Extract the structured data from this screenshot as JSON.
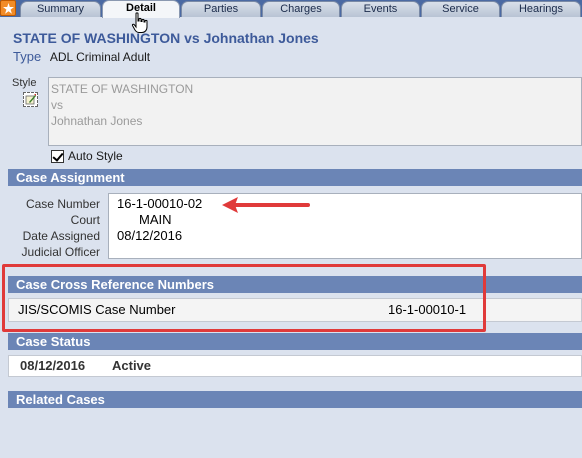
{
  "tabs": [
    "Summary",
    "Detail",
    "Parties",
    "Charges",
    "Events",
    "Service",
    "Hearings"
  ],
  "active_tab": "Detail",
  "case": {
    "title": "STATE OF WASHINGTON vs Johnathan Jones",
    "type_label": "Type",
    "type_value": "ADL Criminal Adult"
  },
  "style": {
    "label": "Style",
    "lines": [
      "STATE OF WASHINGTON",
      "vs",
      "Johnathan Jones"
    ],
    "auto_style_label": "Auto Style",
    "auto_style_checked": true
  },
  "case_assignment": {
    "header": "Case Assignment",
    "labels": [
      "Case Number",
      "Court",
      "Date Assigned",
      "Judicial Officer"
    ],
    "case_number": "16-1-00010-02",
    "court": "MAIN",
    "date_assigned": "08/12/2016",
    "judicial_officer": ""
  },
  "cross_reference": {
    "header": "Case Cross Reference Numbers",
    "key": "JIS/SCOMIS Case Number",
    "value": "16-1-00010-1"
  },
  "case_status": {
    "header": "Case Status",
    "date": "08/12/2016",
    "status": "Active"
  },
  "related_cases": {
    "header": "Related Cases"
  },
  "colors": {
    "tabbar": "#4b6aa3",
    "section_header": "#6b85b6",
    "title": "#3d5a9a",
    "annotation_red": "#e03a3a"
  }
}
